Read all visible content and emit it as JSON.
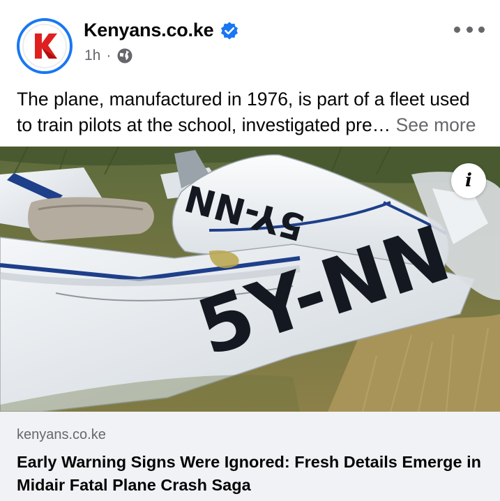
{
  "post": {
    "author": "Kenyans.co.ke",
    "time": "1h",
    "separator": "·",
    "caption": "The plane, manufactured in 1976, is part of a fleet used to train pilots at the school, investigated pre…",
    "see_more": "See more"
  },
  "icons": {
    "avatar": "kenyans-logo-icon",
    "verified": "verified-badge-icon",
    "audience": "globe-icon",
    "more": "more-options-icon",
    "info": "info-icon"
  },
  "photo": {
    "info_label": "i",
    "registration_upper": "5Y-NN",
    "registration_lower": "5Y-NN"
  },
  "link": {
    "domain": "kenyans.co.ke",
    "title": "Early Warning Signs Were Ignored: Fresh Details Emerge in Midair Fatal Plane Crash Saga"
  },
  "colors": {
    "accent": "#1877f2",
    "brand_red": "#e02020",
    "muted_text": "#65676b",
    "footer_bg": "#f0f2f5"
  }
}
